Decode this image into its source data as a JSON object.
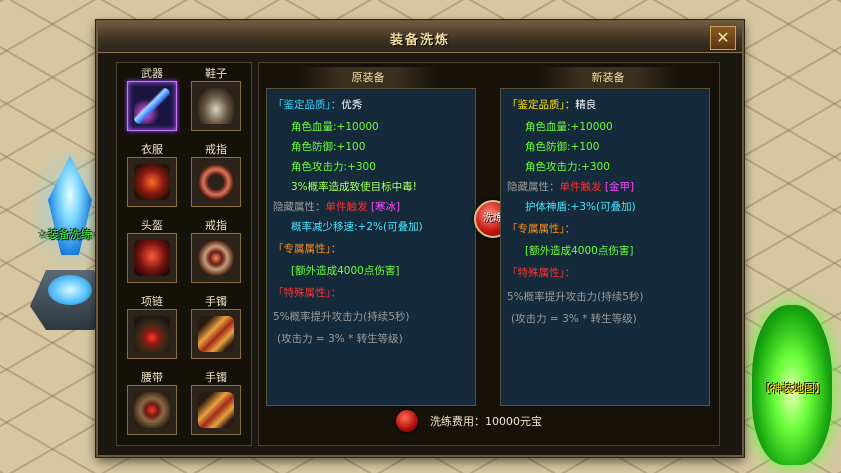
{
  "world": {
    "npc_label": "☆装备洗练☆",
    "portal_label": "【神装地图】"
  },
  "dialog": {
    "title": "装备洗炼",
    "close_label": "✕",
    "slots": [
      {
        "label": "武器",
        "icon": "sword-icon"
      },
      {
        "label": "鞋子",
        "icon": "boots-icon"
      },
      {
        "label": "衣服",
        "icon": "armor-icon"
      },
      {
        "label": "戒指",
        "icon": "ring-icon"
      },
      {
        "label": "头盔",
        "icon": "helmet-icon"
      },
      {
        "label": "戒指",
        "icon": "ring-icon"
      },
      {
        "label": "项链",
        "icon": "necklace-icon"
      },
      {
        "label": "手镯",
        "icon": "bracelet-icon"
      },
      {
        "label": "腰带",
        "icon": "belt-icon"
      },
      {
        "label": "手镯",
        "icon": "bracelet-icon"
      }
    ],
    "original": {
      "header": "原装备",
      "quality_label": "「鉴定品质」：",
      "quality_value": "优秀",
      "stats": [
        "角色血量:+10000",
        "角色防御:+100",
        "角色攻击力:+300"
      ],
      "poison": "3%概率造成致使目标中毒!",
      "hidden_label": "隐藏属性：",
      "hidden_value": "单件触发",
      "hidden_tag": "[寒冰]",
      "hidden_effect": "概率减少移速:+2%(可叠加)",
      "exclusive_label": "「专属属性」：",
      "exclusive_value": "[额外造成4000点伤害]",
      "special_label": "「特殊属性」：",
      "special_line1": "5%概率提升攻击力(持续5秒)",
      "special_line2": "(攻击力 = 3% * 转生等级)"
    },
    "new": {
      "header": "新装备",
      "quality_label": "「鉴定品质」：",
      "quality_value": "精良",
      "stats": [
        "角色血量:+10000",
        "角色防御:+100",
        "角色攻击力:+300"
      ],
      "hidden_label": "隐藏属性：",
      "hidden_value": "单件触发",
      "hidden_tag": "[金甲]",
      "hidden_effect": "护体神盾:+3%(可叠加)",
      "exclusive_label": "「专属属性」：",
      "exclusive_value": "[额外造成4000点伤害]",
      "special_label": "「特殊属性」：",
      "special_line1": "5%概率提升攻击力(持续5秒)",
      "special_line2": "(攻击力 = 3% * 转生等级)"
    },
    "wash_button": "洗炼",
    "cost": "洗练费用：10000元宝"
  }
}
